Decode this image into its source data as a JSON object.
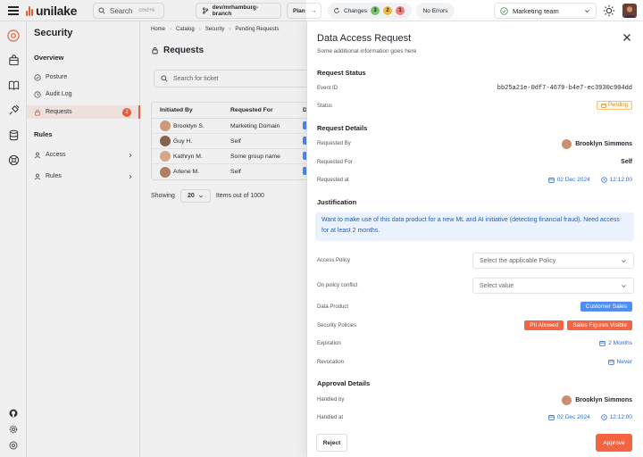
{
  "topbar": {
    "brand": "unilake",
    "search_label": "Search",
    "search_shortcut": "cmd+k",
    "branch": "dev/mrhamburg-branch",
    "plan_label": "Plan",
    "changes_label": "Changes",
    "changes_counts": [
      "3",
      "2",
      "1"
    ],
    "changes_colors": [
      "#7cc36b",
      "#f5b942",
      "#f27a7a"
    ],
    "errors_label": "No Errors",
    "team": "Marketing team"
  },
  "sidenav": {
    "title": "Security",
    "overview_heading": "Overview",
    "items": [
      {
        "label": "Posture",
        "icon": "shield-icon"
      },
      {
        "label": "Audit Log",
        "icon": "clock-icon"
      },
      {
        "label": "Requests",
        "icon": "lock-icon",
        "badge": "2",
        "active": true
      }
    ],
    "rules_heading": "Rules",
    "groups": [
      {
        "label": "Access",
        "icon": "user-icon"
      },
      {
        "label": "Rules",
        "icon": "user-icon"
      }
    ]
  },
  "main": {
    "breadcrumb": [
      "Home",
      "Catalog",
      "Security",
      "Pending Requests"
    ],
    "title": "Requests",
    "search_placeholder": "Search for ticket",
    "columns": [
      "Initiated By",
      "Requested For",
      "D"
    ],
    "rows": [
      {
        "initiator": "Brooklyn S.",
        "requested_for": "Marketing Domain"
      },
      {
        "initiator": "Guy H.",
        "requested_for": "Self"
      },
      {
        "initiator": "Kathryn M.",
        "requested_for": "Some group name"
      },
      {
        "initiator": "Arlene M.",
        "requested_for": "Self"
      }
    ],
    "showing_label": "Showing",
    "page_size": "20",
    "items_label": "Items out of 1000"
  },
  "drawer": {
    "title": "Data Access Request",
    "subtitle": "Some additional information goes here",
    "status_section": "Request Status",
    "event_id_label": "Event ID",
    "event_id": "bb25a21e-0df7-4679-b4e7-ec3930c904dd",
    "status_label": "Status",
    "status_value": "Pending",
    "details_section": "Request Details",
    "requested_by_label": "Requested By",
    "requested_by": "Brooklyn Simmons",
    "requested_for_label": "Requested For",
    "requested_for": "Self",
    "requested_at_label": "Requested at",
    "requested_date": "02 Dec 2024",
    "requested_time": "12:12:00",
    "justification_section": "Justification",
    "justification": "Want to make use of this data product for a new ML and AI initiative (detecting financial fraud). Need access for at least 2 months.",
    "access_policy_label": "Access Policy",
    "access_policy_placeholder": "Select the applicable Policy",
    "conflict_label": "On policy conflict",
    "conflict_placeholder": "Select value",
    "data_product_label": "Data Product",
    "data_product": "Customer Sales",
    "security_policies_label": "Security Policies",
    "security_policies": [
      "PII Allowed",
      "Sales Figures Visible"
    ],
    "expiration_label": "Expiration",
    "expiration": "2 Months",
    "revocation_label": "Revocation",
    "revocation": "Never",
    "approval_section": "Approval Details",
    "handled_by_label": "Handled by",
    "handled_by": "Brooklyn Simmons",
    "handled_at_label": "Handled at",
    "handled_date": "02 Dec 2024",
    "handled_time": "12:12:00",
    "reject_label": "Reject",
    "approve_label": "Approve"
  },
  "colors": {
    "accent": "#f0603a",
    "info": "#4f8ef7",
    "pending": "#d98a1a"
  }
}
